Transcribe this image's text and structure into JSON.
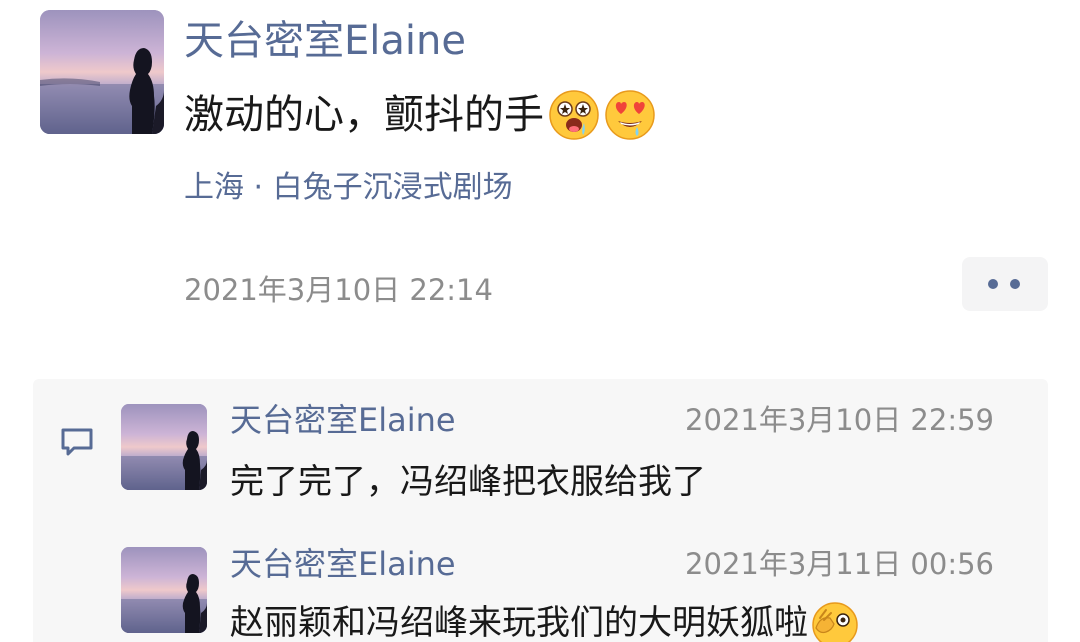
{
  "post": {
    "author": "天台密室Elaine",
    "text": "激动的心，颤抖的手",
    "emojis": [
      "star-struck-drooling-emoji",
      "heart-eyes-drooling-emoji"
    ],
    "location": "上海 · 白兔子沉浸式剧场",
    "timestamp": "2021年3月10日 22:14",
    "more_icon": "ellipsis-icon"
  },
  "comments": [
    {
      "author": "天台密室Elaine",
      "timestamp": "2021年3月10日 22:59",
      "text": "完了完了，冯绍峰把衣服给我了"
    },
    {
      "author": "天台密室Elaine",
      "timestamp": "2021年3月11日 00:56",
      "text": "赵丽颖和冯绍峰来玩我们的大明妖狐啦",
      "emoji": "wink-hand-emoji"
    }
  ],
  "colors": {
    "name_blue": "#576b95",
    "text": "#191919",
    "meta_gray": "#8c8c8c",
    "comment_bg": "#f7f7f7"
  },
  "icons": {
    "comment_icon": "speech-bubble-icon"
  }
}
